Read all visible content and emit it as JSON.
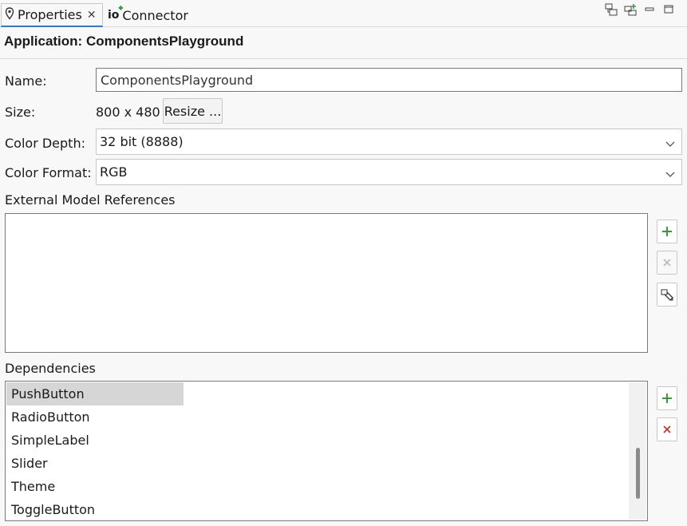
{
  "tabs": [
    {
      "label": "Properties",
      "icon": "pin-icon",
      "active": true
    },
    {
      "label": "Connector",
      "icon": "io-icon",
      "active": false
    }
  ],
  "header": {
    "title": "Application: ComponentsPlayground"
  },
  "name": {
    "label": "Name:",
    "value": "ComponentsPlayground"
  },
  "size": {
    "label": "Size:",
    "value": "800 x 480",
    "resize_button": "Resize ..."
  },
  "color_depth": {
    "label": "Color Depth:",
    "value": "32 bit (8888)"
  },
  "color_format": {
    "label": "Color Format:",
    "value": "RGB"
  },
  "external_refs": {
    "label": "External Model References",
    "items": []
  },
  "dependencies": {
    "label": "Dependencies",
    "items": [
      "PushButton",
      "RadioButton",
      "SimpleLabel",
      "Slider",
      "Theme",
      "ToggleButton"
    ],
    "selected": "PushButton"
  },
  "colors": {
    "accent": "#2b7bd5",
    "add_green": "#3a9a3a",
    "remove_red": "#c0392b",
    "disabled_gray": "#bbbbbb"
  }
}
